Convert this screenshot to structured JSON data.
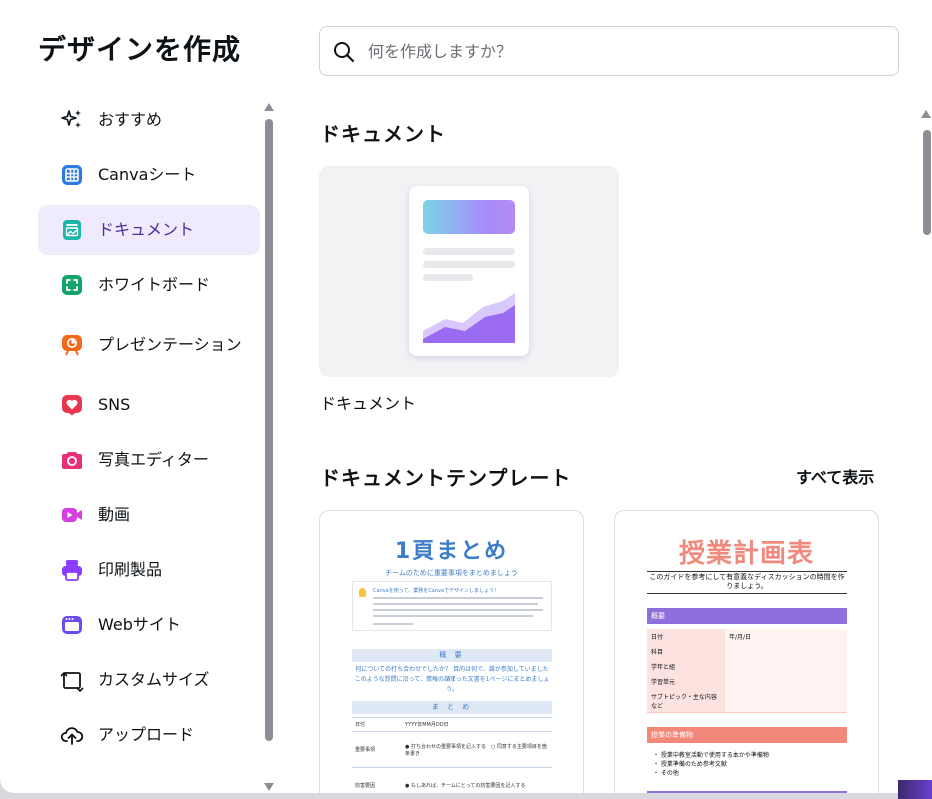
{
  "modal": {
    "title": "デザインを作成"
  },
  "search": {
    "placeholder": "何を作成しますか？",
    "value": ""
  },
  "sidebar": {
    "items": [
      {
        "label": "おすすめ",
        "icon": "sparkle-icon",
        "active": false
      },
      {
        "label": "Canvaシート",
        "icon": "sheet-icon",
        "active": false
      },
      {
        "label": "ドキュメント",
        "icon": "document-icon",
        "active": true
      },
      {
        "label": "ホワイトボード",
        "icon": "whiteboard-icon",
        "active": false
      },
      {
        "label": "プレゼンテーション",
        "icon": "presentation-icon",
        "active": false
      },
      {
        "label": "SNS",
        "icon": "heart-icon",
        "active": false
      },
      {
        "label": "写真エディター",
        "icon": "camera-icon",
        "active": false
      },
      {
        "label": "動画",
        "icon": "video-icon",
        "active": false
      },
      {
        "label": "印刷製品",
        "icon": "printer-icon",
        "active": false
      },
      {
        "label": "Webサイト",
        "icon": "website-icon",
        "active": false
      },
      {
        "label": "カスタムサイズ",
        "icon": "custom-size-icon",
        "active": false
      },
      {
        "label": "アップロード",
        "icon": "upload-icon",
        "active": false
      }
    ]
  },
  "main": {
    "section1_title": "ドキュメント",
    "doc_card_caption": "ドキュメント",
    "section2_title": "ドキュメントテンプレート",
    "see_all": "すべて表示",
    "templates": [
      {
        "title": "1頁まとめ",
        "subtitle": "チームのために重要事項をまとめましょう",
        "box_heading": "Canvaを使って、業務をCanvaでデザインしましょう！",
        "band1": "概 要",
        "summary_line1": "何についての打ち合わせでしたか？ 目的は何で、誰が参加していましたか？",
        "summary_line2": "このような質問に沿って、情報の詰まった文書を1ページにまとめましょう。",
        "band2": "ま と め",
        "rows": [
          {
            "k": "日付",
            "v": "YYYY年MM月DD日"
          },
          {
            "k": "重要事項",
            "v": "● 打ち合わせの重要事項を記入する　○ 同意する主要項目を箇条書き"
          },
          {
            "k": "妨害要因",
            "v": "● もしあれば、チームにとっての妨害要因を記入する"
          }
        ]
      },
      {
        "title": "授業計画表",
        "subtitle": "このガイドを参考にして有意義なディスカッションの時間を作りましょう。",
        "section_a": "概要",
        "rows": [
          {
            "k": "日付",
            "v": "年/月/日"
          },
          {
            "k": "科目",
            "v": ""
          },
          {
            "k": "学年と組",
            "v": ""
          },
          {
            "k": "学習単元",
            "v": ""
          },
          {
            "k": "サブトピック・主な内容など",
            "v": ""
          }
        ],
        "section_b": "授業の準備物",
        "list": [
          "・ 授業中教室活動で使用する本かや準備物",
          "・ 授業準備のため参考文献",
          "・ その他"
        ]
      }
    ]
  },
  "colors": {
    "accent": "#8b3dff",
    "active_bg": "#efeafc",
    "active_text": "#4a2f9d"
  }
}
